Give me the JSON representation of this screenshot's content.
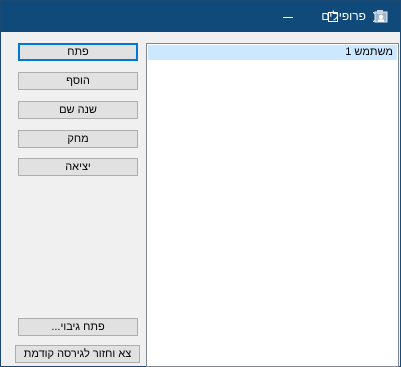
{
  "window": {
    "title": "פרופילים",
    "app_icon": "profile-app-icon",
    "titlebar_color": "#0f4a7a"
  },
  "buttons": {
    "open": "פתח",
    "add": "הוסף",
    "rename": "שנה שם",
    "delete": "מחק",
    "exit": "יציאה",
    "open_backup": "פתח גיבוי...",
    "exit_restore": "צא וחזור לגירסה קודמת"
  },
  "profiles": {
    "items": [
      "משתמש 1"
    ],
    "selected_index": 0,
    "selection_color": "#cce8ff"
  }
}
